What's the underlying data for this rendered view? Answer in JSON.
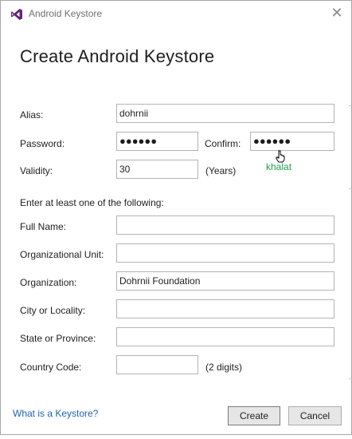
{
  "window": {
    "title": "Android Keystore",
    "close_glyph": "✕"
  },
  "dialog": {
    "heading": "Create Android Keystore"
  },
  "form": {
    "alias": {
      "label": "Alias:",
      "value": "dohrnii"
    },
    "password": {
      "label": "Password:",
      "value": "●●●●●●"
    },
    "confirm": {
      "label": "Confirm:",
      "value": "●●●●●●"
    },
    "validity": {
      "label": "Validity:",
      "value": "30",
      "unit": "(Years)"
    },
    "instructions": "Enter at least one of the following:",
    "full_name": {
      "label": "Full Name:",
      "value": ""
    },
    "org_unit": {
      "label": "Organizational Unit:",
      "value": ""
    },
    "organization": {
      "label": "Organization:",
      "value": "Dohrnii Foundation"
    },
    "city": {
      "label": "City or Locality:",
      "value": ""
    },
    "state": {
      "label": "State or Province:",
      "value": ""
    },
    "country": {
      "label": "Country Code:",
      "value": "",
      "hint": "(2 digits)"
    }
  },
  "annotation": {
    "text": "khalat",
    "color": "#21a04a"
  },
  "footer": {
    "link": "What is a Keystore?",
    "create_label": "Create",
    "cancel_label": "Cancel"
  },
  "colors": {
    "link": "#1e62b4",
    "vs_purple": "#68217a"
  },
  "icons": {
    "logo": "visual-studio-icon",
    "cursor": "hand-cursor-icon"
  }
}
